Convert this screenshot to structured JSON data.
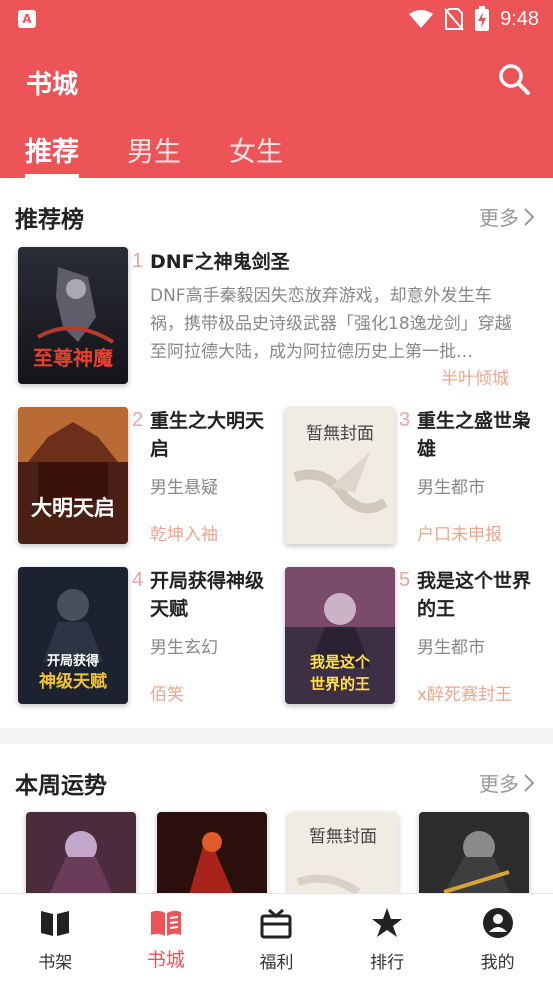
{
  "status": {
    "time": "9:48"
  },
  "header": {
    "title": "书城"
  },
  "tabs": [
    {
      "label": "推荐"
    },
    {
      "label": "男生"
    },
    {
      "label": "女生"
    }
  ],
  "ranking": {
    "title": "推荐榜",
    "more": "更多",
    "books": [
      {
        "rank": "1",
        "title": "DNF之神鬼剑圣",
        "desc": "DNF高手秦毅因失恋放弃游戏，却意外发生车祸，携带极品史诗级武器「强化18逸龙剑」穿越至阿拉德大陆，成为阿拉德历史上第一批…",
        "author": "半叶倾城"
      },
      {
        "rank": "2",
        "title": "重生之大明天启",
        "genre": "男生悬疑",
        "author": "乾坤入袖"
      },
      {
        "rank": "3",
        "title": "重生之盛世枭雄",
        "genre": "男生都市",
        "author": "户口未申报"
      },
      {
        "rank": "4",
        "title": "开局获得神级天赋",
        "genre": "男生玄幻",
        "author": "佰笑"
      },
      {
        "rank": "5",
        "title": "我是这个世界的王",
        "genre": "男生都市",
        "author": "x醉死赛封王"
      }
    ]
  },
  "weekly": {
    "title": "本周运势",
    "more": "更多"
  },
  "covers": {
    "c1": "至尊神魔",
    "c2": "大明天启",
    "c3": "暂無封面",
    "c4": "开局获得 神级天赋",
    "c5": "我是这个 世界的王",
    "c9": "暂無封面"
  },
  "nav": [
    {
      "label": "书架",
      "icon": "bookshelf-icon"
    },
    {
      "label": "书城",
      "icon": "bookstore-icon"
    },
    {
      "label": "福利",
      "icon": "gift-icon"
    },
    {
      "label": "排行",
      "icon": "ranking-icon"
    },
    {
      "label": "我的",
      "icon": "profile-icon"
    }
  ],
  "colors": {
    "accent": "#ec5458",
    "author": "#e9a78d",
    "rank": "#e8a3a5"
  }
}
